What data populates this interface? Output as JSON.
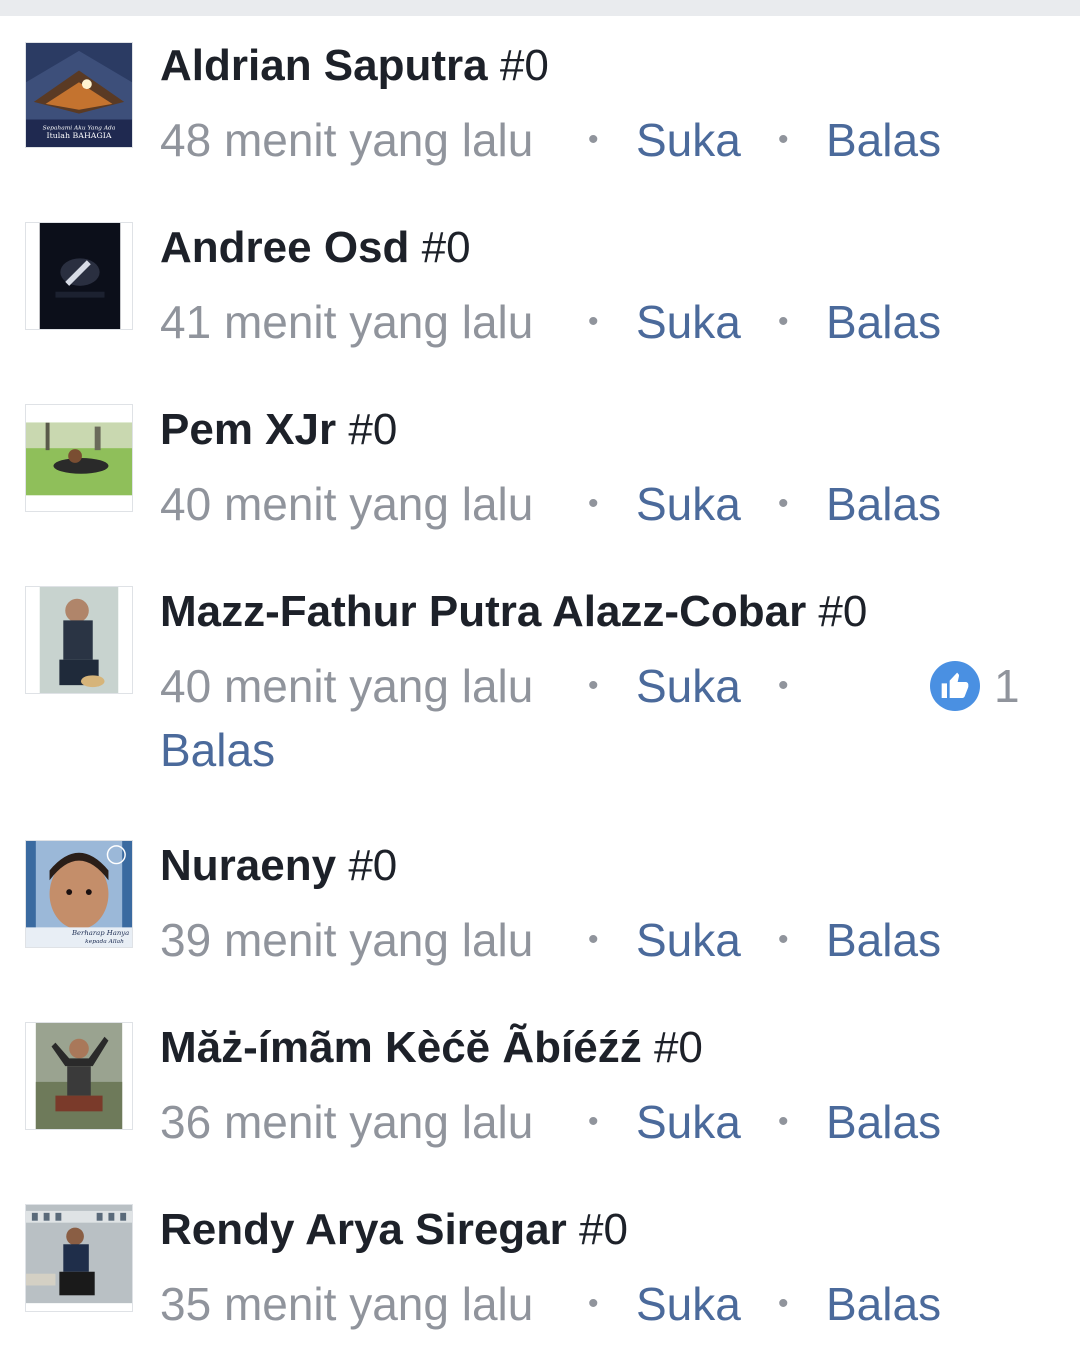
{
  "comments": [
    {
      "name": "Aldrian Saputra",
      "tag": "#0",
      "time": "48 menit yang lalu",
      "like": "Suka",
      "reply": "Balas",
      "avatar_caption_1": "Sepahami Aku Yang Ada",
      "avatar_caption_2": "Itulah BAHAGIA"
    },
    {
      "name": "Andree Osd",
      "tag": "#0",
      "time": "41 menit yang lalu",
      "like": "Suka",
      "reply": "Balas"
    },
    {
      "name": "Pem XJr",
      "tag": "#0",
      "time": "40 menit yang lalu",
      "like": "Suka",
      "reply": "Balas"
    },
    {
      "name": "Mazz-Fathur Putra Alazz-Cobar",
      "tag": "#0",
      "time": "40 menit yang lalu",
      "like": "Suka",
      "reply": "Balas",
      "reaction_count": "1"
    },
    {
      "name": "Nuraeny",
      "tag": "#0",
      "time": "39 menit yang lalu",
      "like": "Suka",
      "reply": "Balas",
      "avatar_caption_1": "Berharap Hanya",
      "avatar_caption_2": "kepada Allah"
    },
    {
      "name": "Măż-ímãm Kèćĕ Ãbíéźź",
      "tag": "#0",
      "time": "36 menit yang lalu",
      "like": "Suka",
      "reply": "Balas"
    },
    {
      "name": "Rendy Arya Siregar",
      "tag": "#0",
      "time": "35 menit yang lalu",
      "like": "Suka",
      "reply": "Balas"
    }
  ],
  "colors": {
    "link": "#4b6a9b",
    "meta": "#90949c",
    "name": "#1d2129",
    "like_badge": "#4a90e2"
  },
  "icons": {
    "reaction": "thumbs-up-icon"
  }
}
